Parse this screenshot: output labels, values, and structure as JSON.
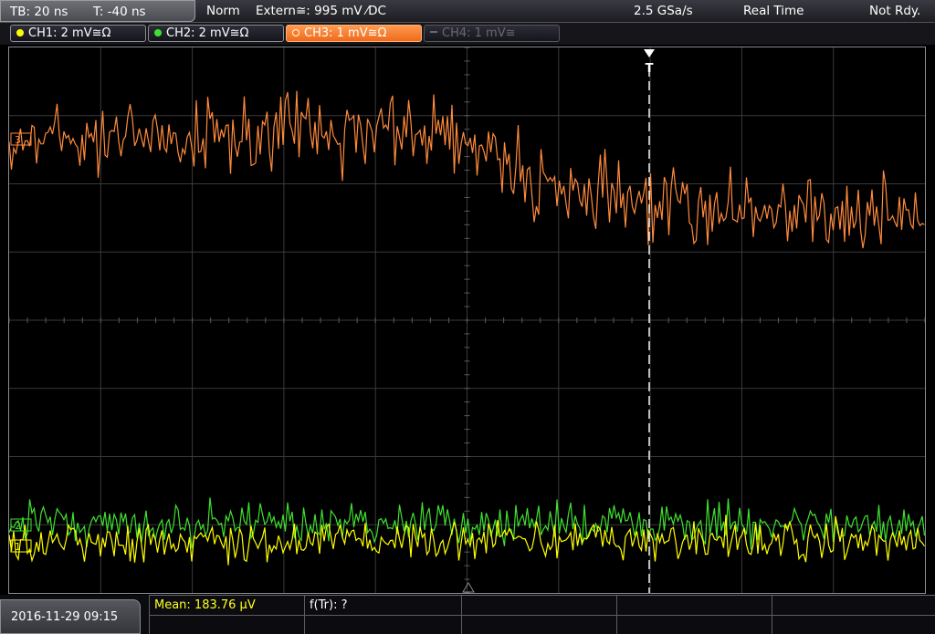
{
  "topbar": {
    "timebase": "TB: 20 ns",
    "trigger_time": "T: -40 ns",
    "mode": "Norm",
    "trigger_source": "Extern≅: 995 mV ⁄DC",
    "sample_rate": "2.5 GSa/s",
    "acq_mode": "Real Time",
    "status": "Not Rdy."
  },
  "channels": [
    {
      "label": "CH1: 2 mV≅Ω",
      "color": "#ffff00",
      "state": "on"
    },
    {
      "label": "CH2: 2 mV≅Ω",
      "color": "#40e030",
      "state": "on"
    },
    {
      "label": "CH3: 1 mV≅Ω",
      "color": "#ff8a3c",
      "state": "active"
    },
    {
      "label": "CH4: 1 mV≅",
      "color": "#6a6a6a",
      "state": "off"
    }
  ],
  "colors": {
    "ch1": "#ffff00",
    "ch2": "#40e030",
    "ch3": "#ff8a3c",
    "grid": "#3a3a3a",
    "trigger_marker": "#ffffff"
  },
  "plot": {
    "trigger_label": "T",
    "ch1_marker": "1",
    "ch2_marker": "2",
    "ch3_marker": "3"
  },
  "bottombar": {
    "datetime": "2016-11-29 09:15",
    "mean": "Mean: 183.76 µV",
    "ftr": "f(Tr): ?"
  }
}
